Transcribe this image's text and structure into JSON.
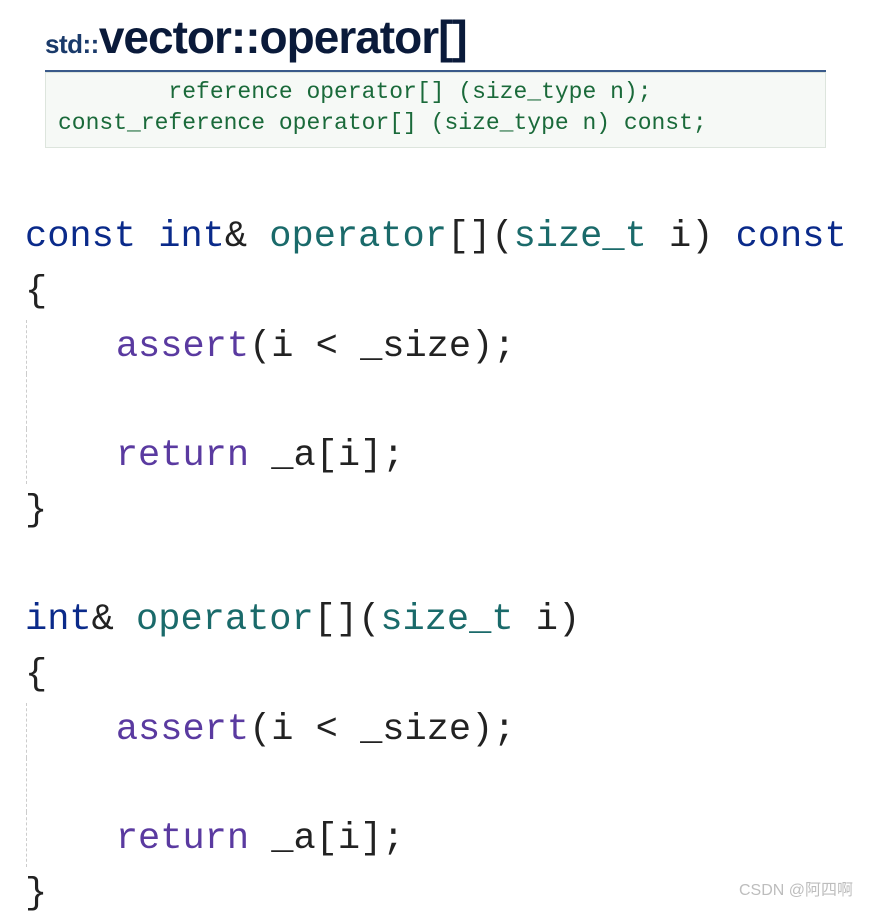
{
  "header": {
    "prefix": "std::",
    "main": "vector::operator[]",
    "sig1": "        reference operator[] (size_type n);",
    "sig2": "const_reference operator[] (size_type n) const;"
  },
  "code": {
    "f1": {
      "t1": "const",
      "t2": " ",
      "t3": "int",
      "t4": "& ",
      "t5": "operator",
      "t6": "[](",
      "t7": "size_t",
      "t8": " i) ",
      "t9": "const"
    },
    "f2": {
      "t1": "int",
      "t2": "& ",
      "t3": "operator",
      "t4": "[](",
      "t5": "size_t",
      "t6": " i)"
    },
    "brace_open": "{",
    "brace_close": "}",
    "l_assert_a": "    ",
    "l_assert_fn": "assert",
    "l_assert_b": "(i < _size);",
    "blank": " ",
    "ret_a": "    ",
    "ret_kw": "return",
    "ret_b": " _a[i];"
  },
  "watermark": "CSDN @阿四啊"
}
